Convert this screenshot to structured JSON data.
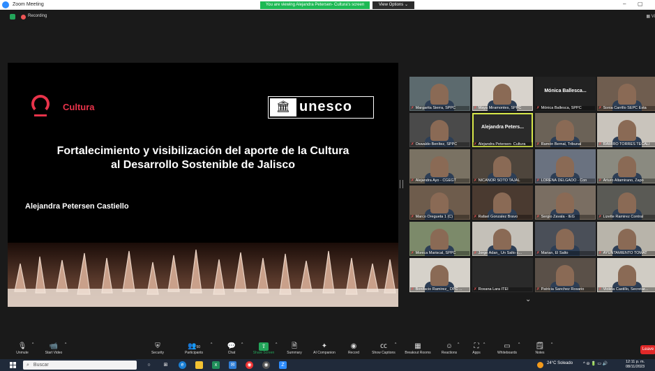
{
  "window": {
    "title": "Zoom Meeting",
    "banner": "You are viewing Alejandra Petersen- Cultura's screen",
    "view_options": "View Options",
    "view_options_caret": "⌄",
    "minimize": "–",
    "restore": "▢"
  },
  "meeting": {
    "recording_label": "Recording",
    "view_label": "Vi"
  },
  "slide": {
    "cultura_label": "Cultura",
    "unesco_label": "unesco",
    "title_line1": "Fortalecimiento y visibilización del aporte de la Cultura",
    "title_line2": "al Desarrollo Sostenible de Jalisco",
    "author": "Alejandra Petersen Castiello"
  },
  "participants": [
    {
      "name": "Margarita Sierra, SPPC"
    },
    {
      "name": "Maya Miramontes, SPPC"
    },
    {
      "name": "Mónica Ballesca, SPPC",
      "big": "Mónica Ballesca..."
    },
    {
      "name": "Sonia Carrillo SEPC Esta"
    },
    {
      "name": "Oswaldo Benítez, SPPC"
    },
    {
      "name": "Alejandra Petersen- Cultura",
      "big": "Alejandra Peters..."
    },
    {
      "name": "Ramón Bernal, Tribunal"
    },
    {
      "name": "RAMIRO TORRES TECALI"
    },
    {
      "name": "Alejandra Ayo - CGEGT"
    },
    {
      "name": "NICANOR SOTO TAJAL"
    },
    {
      "name": "LORENA DELGADO - Con"
    },
    {
      "name": "Arturo Altamirano, Zapo"
    },
    {
      "name": "Marco Oregueta 1 (C)"
    },
    {
      "name": "Rafael Gonzalez Bravo"
    },
    {
      "name": "Sergio Zavala - IEG"
    },
    {
      "name": "Lizette Ramirez Contral"
    },
    {
      "name": "Monica Mariscal, SPPC"
    },
    {
      "name": "Jorge Adan_ Un Salto c..."
    },
    {
      "name": "Marian, El Salto"
    },
    {
      "name": "AYUNTAMIENTO TOMAT"
    },
    {
      "name": "Bonifacio Ramirez_ DPC ..."
    },
    {
      "name": "Roxana Lara ITEI"
    },
    {
      "name": "Patricia Sanchez Rosario"
    },
    {
      "name": "Violeta Castillo, Secretar..."
    }
  ],
  "gallery_next_caret": "⌄",
  "toolbar": {
    "unmute": "Unmute",
    "start_video": "Start Video",
    "security": "Security",
    "participants": "Participants",
    "participants_count": "50",
    "chat": "Chat",
    "share_screen": "Share Screen",
    "summary": "Summary",
    "ai_companion": "AI Companion",
    "record": "Record",
    "show_captions": "Show Captions",
    "breakout_rooms": "Breakout Rooms",
    "reactions": "Reactions",
    "apps": "Apps",
    "whiteboards": "Whiteboards",
    "notes": "Notes",
    "leave": "Leave",
    "caret": "^"
  },
  "taskbar": {
    "search_placeholder": "Buscar",
    "weather": "24°C Soleado",
    "time": "12:11 p. m.",
    "date": "08/11/2023"
  }
}
